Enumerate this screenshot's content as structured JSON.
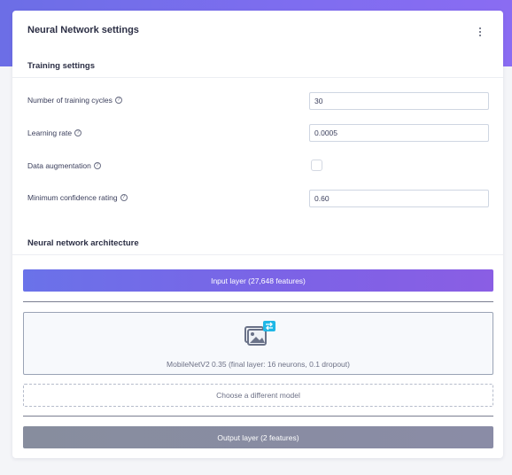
{
  "header": {
    "title": "Neural Network settings",
    "menu_icon": "kebab-menu-icon"
  },
  "training": {
    "section_title": "Training settings",
    "fields": [
      {
        "label": "Number of training cycles",
        "value": "30"
      },
      {
        "label": "Learning rate",
        "value": "0.0005"
      },
      {
        "label": "Data augmentation",
        "checked": false
      },
      {
        "label": "Minimum confidence rating",
        "value": "0.60"
      }
    ],
    "help_glyph": "?"
  },
  "architecture": {
    "section_title": "Neural network architecture",
    "input_layer": "Input layer (27,648 features)",
    "model_icon": "image-transfer-icon",
    "model_text": "MobileNetV2 0.35 (final layer: 16 neurons, 0.1 dropout)",
    "choose_model": "Choose a different model",
    "output_layer": "Output layer (2 features)"
  },
  "colors": {
    "accent": "#7a68ec",
    "output": "#878d9e",
    "icon_badge": "#1fb7e6"
  }
}
